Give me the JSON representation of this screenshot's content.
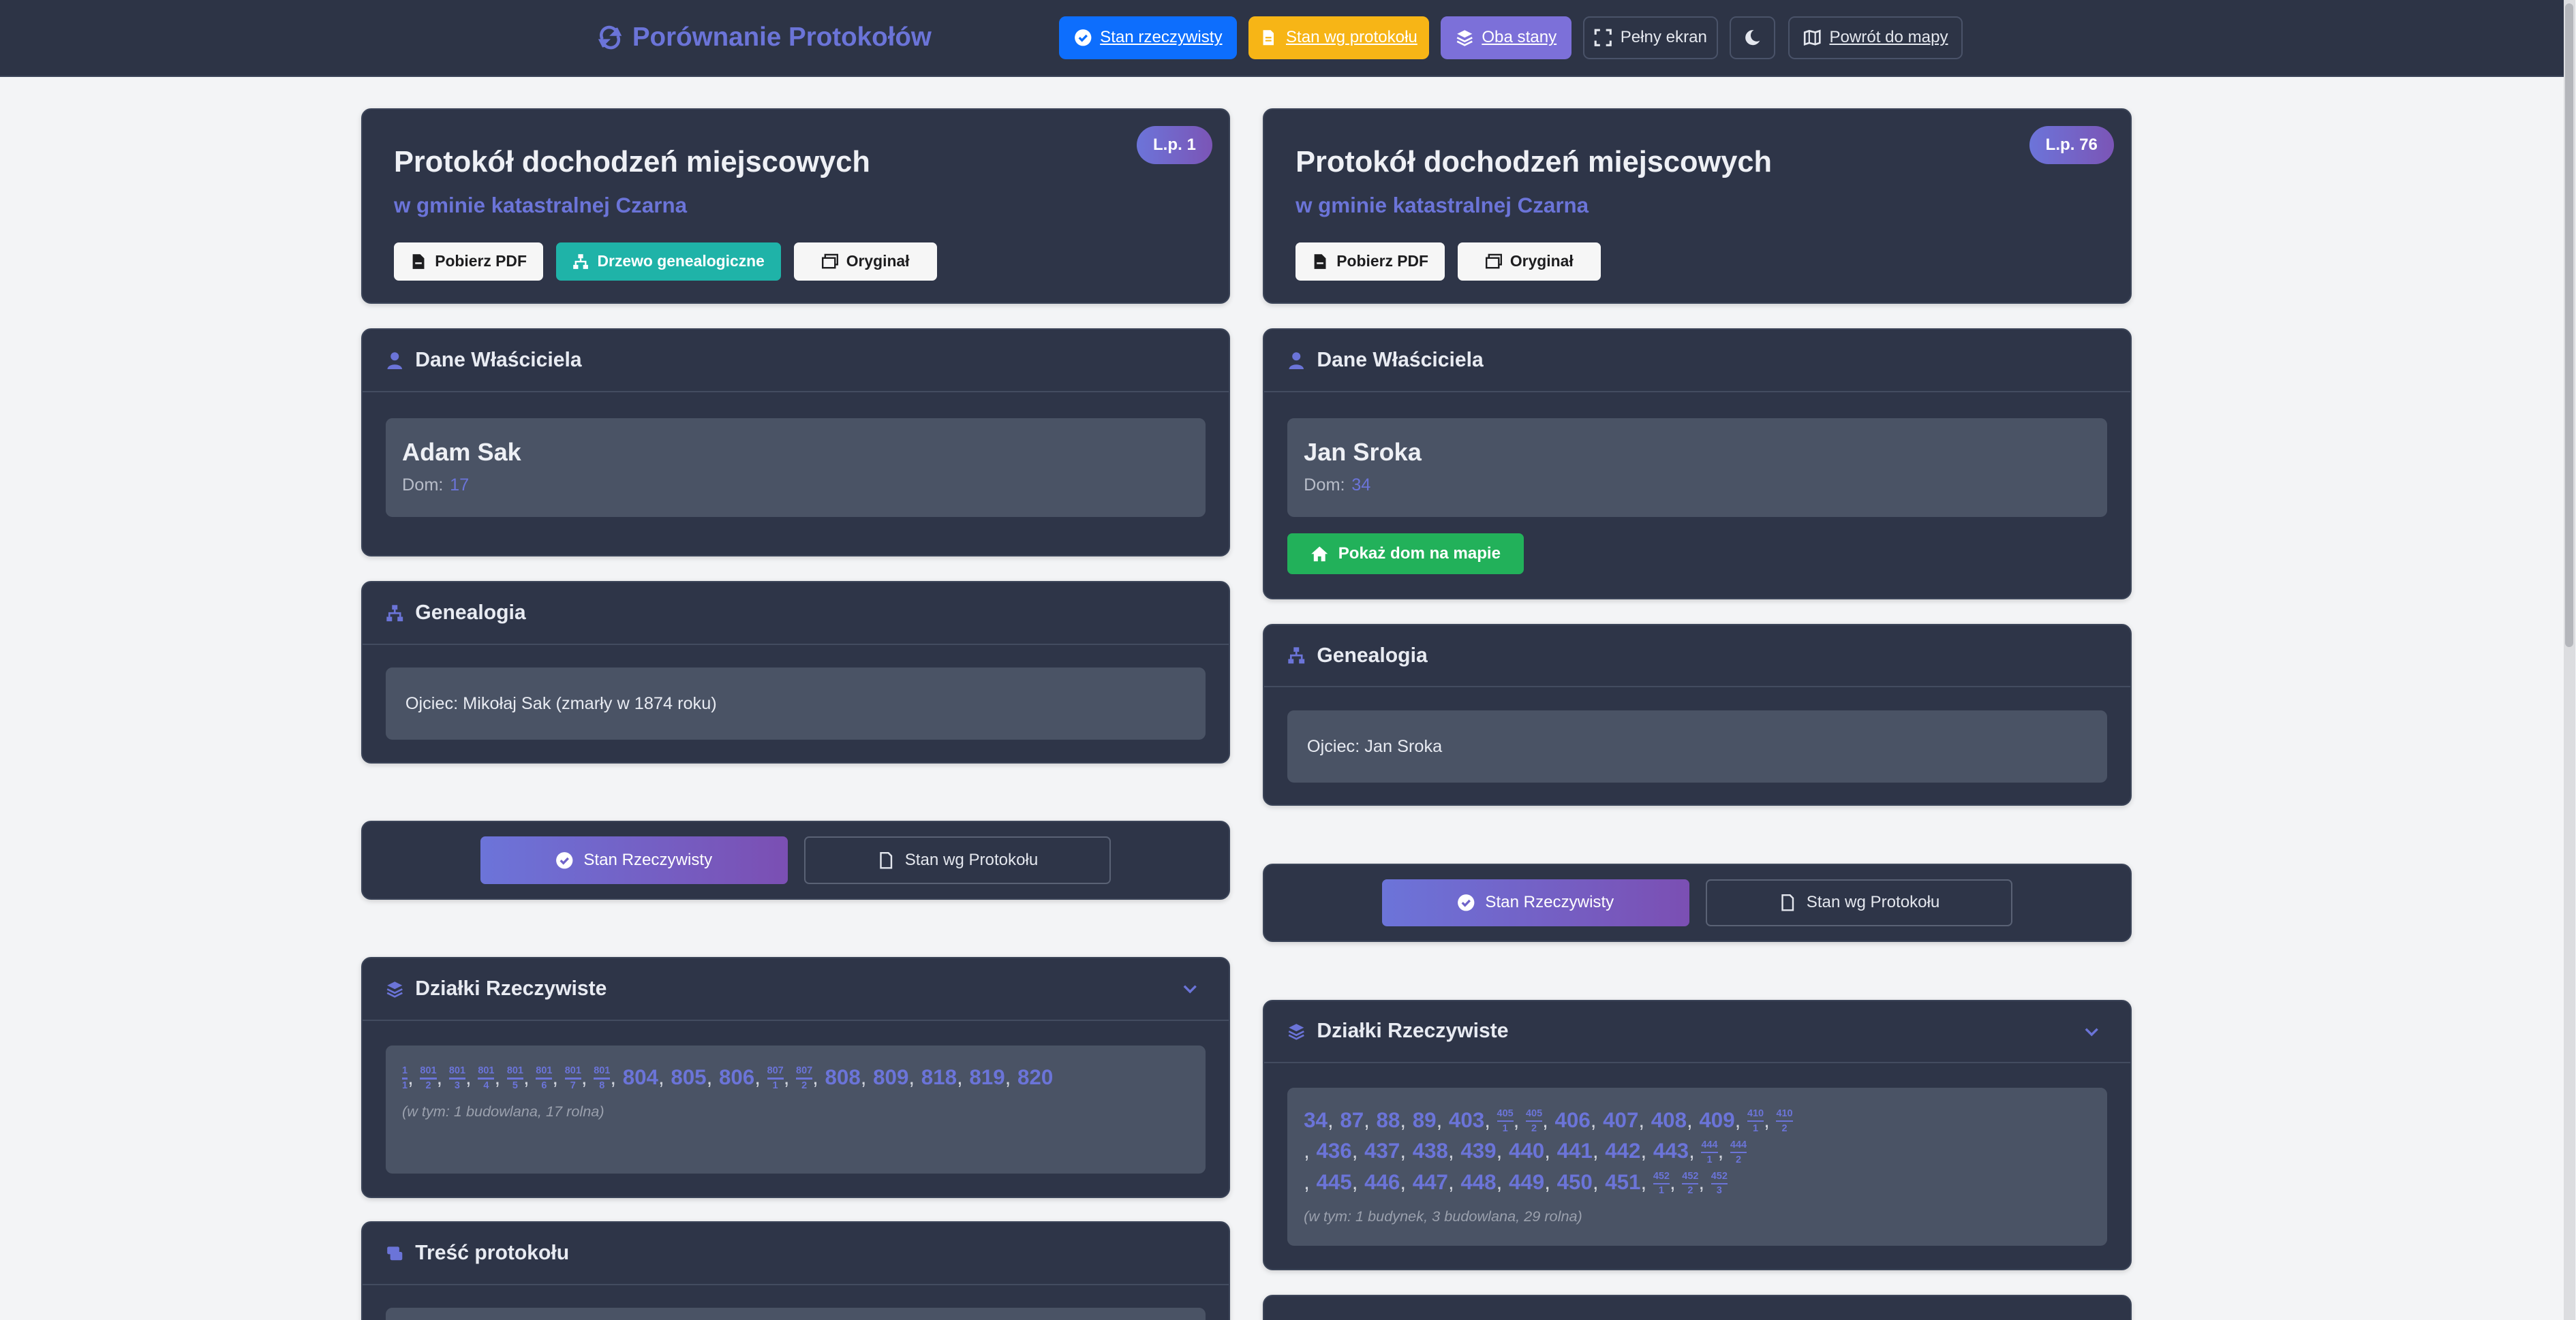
{
  "topbar": {
    "brand": "Porównanie Protokołów",
    "btn_real": "Stan rzeczywisty",
    "btn_protocol": "Stan wg protokołu",
    "btn_both": "Oba stany",
    "btn_fullscreen": "Pełny ekran",
    "btn_back_map": "Powrót do mapy"
  },
  "colors": {
    "accent": "#6b74d8",
    "real": "#0d6efd",
    "protocol": "#f7b516",
    "both": "#7c70d9",
    "teal": "#1fb3a8",
    "green": "#22b15a",
    "card": "#2e3548"
  },
  "left": {
    "title": "Protokół dochodzeń miejscowych",
    "subtitle": "w gminie katastralnej Czarna",
    "lp": "L.p. 1",
    "btn_pdf": "Pobierz PDF",
    "btn_tree": "Drzewo genealogiczne",
    "btn_original": "Oryginał",
    "owner_section": "Dane Właściciela",
    "owner_name": "Adam Sak",
    "house_label": "Dom:",
    "house_number": "17",
    "genealogy_section": "Genealogia",
    "genealogy_text": "Ojciec: Mikołaj Sak (zmarły w 1874 roku)",
    "toggle_real": "Stan Rzeczywisty",
    "toggle_protocol": "Stan wg Protokołu",
    "parcels_section": "Działki Rzeczywiste",
    "parcels": [
      {
        "n": "1",
        "d": "1"
      },
      {
        "n": "801",
        "d": "2"
      },
      {
        "n": "801",
        "d": "3"
      },
      {
        "n": "801",
        "d": "4"
      },
      {
        "n": "801",
        "d": "5"
      },
      {
        "n": "801",
        "d": "6"
      },
      {
        "n": "801",
        "d": "7"
      },
      {
        "n": "801",
        "d": "8"
      },
      {
        "v": "804"
      },
      {
        "v": "805"
      },
      {
        "v": "806"
      },
      {
        "n": "807",
        "d": "1"
      },
      {
        "n": "807",
        "d": "2"
      },
      {
        "v": "808"
      },
      {
        "v": "809"
      },
      {
        "v": "818"
      },
      {
        "v": "819"
      },
      {
        "v": "820"
      }
    ],
    "parcels_note": "(w tym: 1 budowlana, 17 rolna)",
    "content_section": "Treść protokołu"
  },
  "right": {
    "title": "Protokół dochodzeń miejscowych",
    "subtitle": "w gminie katastralnej Czarna",
    "lp": "L.p. 76",
    "btn_pdf": "Pobierz PDF",
    "btn_original": "Oryginał",
    "owner_section": "Dane Właściciela",
    "owner_name": "Jan Sroka",
    "house_label": "Dom:",
    "house_number": "34",
    "map_button": "Pokaż dom na mapie",
    "genealogy_section": "Genealogia",
    "genealogy_text": "Ojciec: Jan Sroka",
    "toggle_real": "Stan Rzeczywisty",
    "toggle_protocol": "Stan wg Protokołu",
    "parcels_section": "Działki Rzeczywiste",
    "parcels": [
      {
        "v": "34"
      },
      {
        "v": "87"
      },
      {
        "v": "88"
      },
      {
        "v": "89"
      },
      {
        "v": "403"
      },
      {
        "n": "405",
        "d": "1"
      },
      {
        "n": "405",
        "d": "2"
      },
      {
        "v": "406"
      },
      {
        "v": "407"
      },
      {
        "v": "408"
      },
      {
        "v": "409"
      },
      {
        "n": "410",
        "d": "1"
      },
      {
        "n": "410",
        "d": "2"
      },
      {
        "v": "436"
      },
      {
        "v": "437"
      },
      {
        "v": "438"
      },
      {
        "v": "439"
      },
      {
        "v": "440"
      },
      {
        "v": "441"
      },
      {
        "v": "442"
      },
      {
        "v": "443"
      },
      {
        "n": "444",
        "d": "1"
      },
      {
        "n": "444",
        "d": "2"
      },
      {
        "v": "445"
      },
      {
        "v": "446"
      },
      {
        "v": "447"
      },
      {
        "v": "448"
      },
      {
        "v": "449"
      },
      {
        "v": "450"
      },
      {
        "v": "451"
      },
      {
        "n": "452",
        "d": "1"
      },
      {
        "n": "452",
        "d": "2"
      },
      {
        "n": "452",
        "d": "3"
      }
    ],
    "parcels_note": "(w tym: 1 budynek, 3 budowlana, 29 rolna)"
  }
}
